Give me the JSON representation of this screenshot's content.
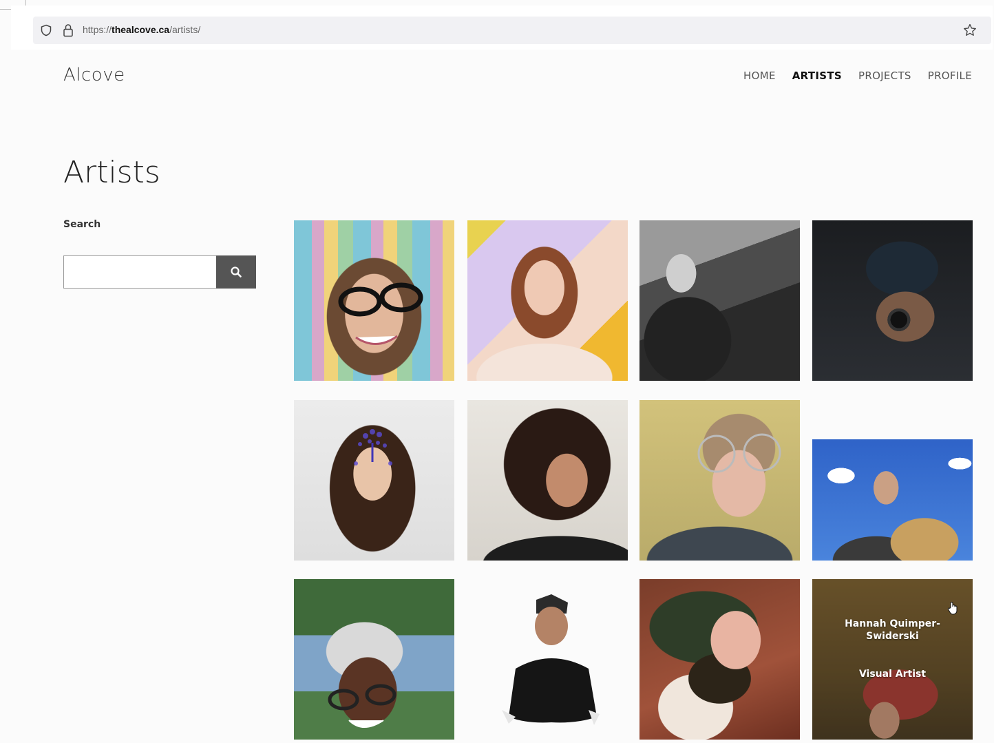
{
  "browser": {
    "url_prefix": "https://",
    "url_domain": "thealcove.ca",
    "url_path": "/artists/"
  },
  "site": {
    "logo": "Alcove",
    "nav": [
      {
        "label": "HOME",
        "active": false
      },
      {
        "label": "ARTISTS",
        "active": true
      },
      {
        "label": "PROJECTS",
        "active": false
      },
      {
        "label": "PROFILE",
        "active": false
      }
    ]
  },
  "page": {
    "title": "Artists",
    "search_label": "Search",
    "search_value": ""
  },
  "artists": [
    {
      "id": 1
    },
    {
      "id": 2
    },
    {
      "id": 3
    },
    {
      "id": 4
    },
    {
      "id": 5
    },
    {
      "id": 6
    },
    {
      "id": 7
    },
    {
      "id": 8
    },
    {
      "id": 9
    },
    {
      "id": 10
    },
    {
      "id": 11
    },
    {
      "id": 12,
      "hover_name": "Hannah Quimper-Swiderski",
      "hover_role": "Visual Artist"
    }
  ]
}
